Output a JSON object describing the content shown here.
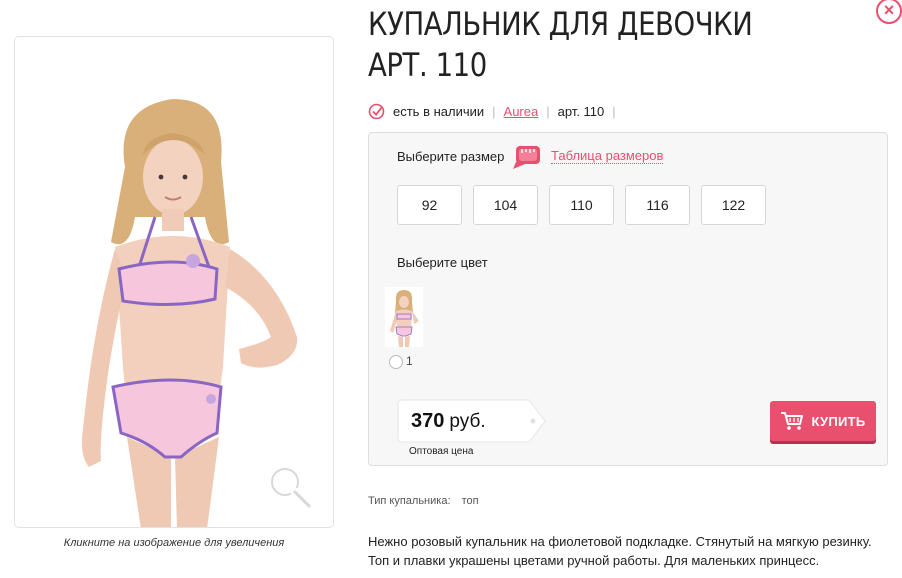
{
  "product": {
    "title": "КУПАЛЬНИК ДЛЯ ДЕВОЧКИ АРТ. 110",
    "availability": "есть в наличии",
    "brand": "Aurea",
    "article": "арт. 110",
    "separator": "|"
  },
  "image": {
    "caption": "Кликните на изображение для увеличения"
  },
  "options": {
    "size_label": "Выберите размер",
    "size_table_link": "Таблица размеров",
    "sizes": [
      "92",
      "104",
      "110",
      "116",
      "122"
    ],
    "color_label": "Выберите цвет",
    "colors": [
      {
        "number": "1"
      }
    ]
  },
  "price": {
    "amount": "370",
    "currency": "руб.",
    "note": "Оптовая цена"
  },
  "buy_button": {
    "label": "КУПИТЬ"
  },
  "attributes": [
    {
      "label": "Тип купальника:",
      "value": "топ"
    }
  ],
  "description": "Нежно розовый купальник на фиолетовой подкладке. Стянутый на мягкую резинку. Топ и плавки украшены цветами ручной работы. Для маленьких принцесс.",
  "colors": {
    "accent": "#e8506d",
    "swimsuit_pink": "#f5c6dc",
    "swimsuit_trim": "#8a66c4"
  },
  "icons": {
    "close": "close-icon",
    "check": "check-circle-icon",
    "tape": "measuring-tape-icon",
    "cart": "cart-icon",
    "zoom": "magnifier-icon"
  }
}
